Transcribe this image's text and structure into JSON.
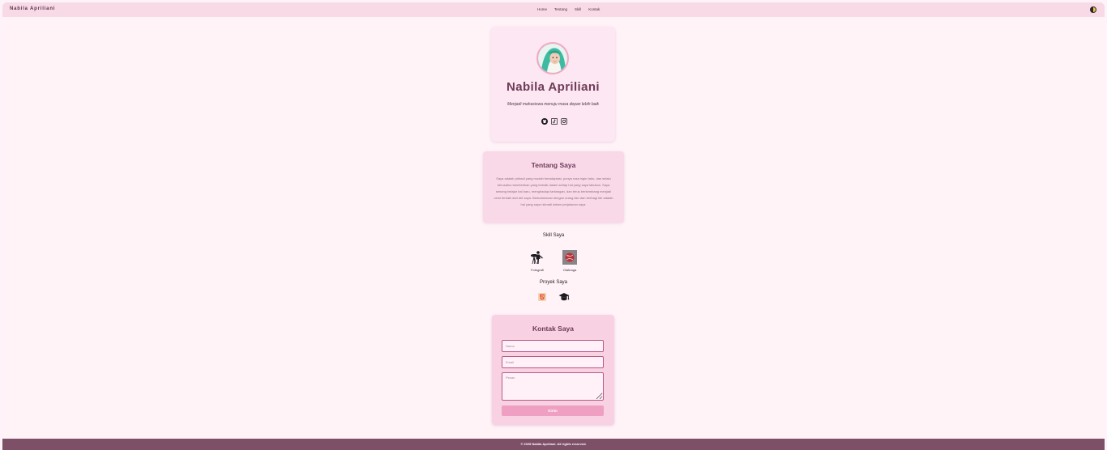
{
  "navbar": {
    "brand": "Nabila Apriliani",
    "links": [
      "Home",
      "Tentang",
      "Skill",
      "Kontak"
    ],
    "theme_toggle_icon": "half-moon-icon"
  },
  "profile": {
    "name": "Nabila Apriliani",
    "tagline": "Menjadi mahasiswa menuju masa depan lebih baik",
    "social_icons": [
      "github-icon",
      "tiktok-icon",
      "instagram-icon"
    ]
  },
  "about": {
    "title": "Tentang Saya",
    "text": "Saya adalah pribadi yang mudah beradaptasi, punya rasa ingin tahu, dan selalu berusaha memberikan yang terbaik dalam setiap hal yang saya lakukan. Saya senang belajar hal baru, menghadapi tantangan, dan terus berkembang menjadi versi terbaik dari diri saya. Berkolaborasi dengan orang lain dan berbagi ide adalah hal yang saya nikmati dalam perjalanan saya."
  },
  "skills": {
    "title": "Skill Saya",
    "items": [
      {
        "label": "Fotografi",
        "icon": "photographer-icon"
      },
      {
        "label": "Olahraga",
        "icon": "sport-ball-icon"
      }
    ]
  },
  "projects": {
    "title": "Proyek Saya",
    "icons": [
      "html5-icon",
      "graduation-cap-icon"
    ]
  },
  "contact": {
    "title": "Kontak Saya",
    "name_placeholder": "Nama",
    "email_placeholder": "Email",
    "message_placeholder": "Pesan",
    "send_label": "Kirim"
  },
  "footer": {
    "text": "© 2025 Nabila Apriliani. All rights reserved."
  },
  "colors": {
    "accent": "#6d3b58",
    "navbar_bg": "#f8d9e6",
    "footer_bg": "#7d5068",
    "button_bg": "#ee9fc2"
  }
}
